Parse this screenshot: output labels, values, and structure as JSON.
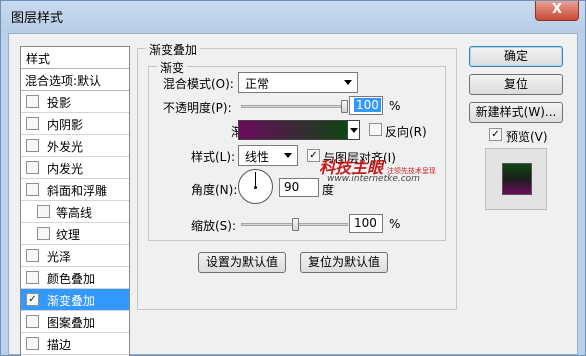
{
  "window": {
    "title": "图层样式",
    "close_label": "X"
  },
  "styles_list": {
    "header": "样式",
    "subheader": "混合选项:默认",
    "items": [
      {
        "label": "投影",
        "checked": false
      },
      {
        "label": "内阴影",
        "checked": false
      },
      {
        "label": "外发光",
        "checked": false
      },
      {
        "label": "内发光",
        "checked": false
      },
      {
        "label": "斜面和浮雕",
        "checked": false
      },
      {
        "label": "等高线",
        "checked": false
      },
      {
        "label": "纹理",
        "checked": false
      },
      {
        "label": "光泽",
        "checked": false
      },
      {
        "label": "颜色叠加",
        "checked": false
      },
      {
        "label": "渐变叠加",
        "checked": true,
        "selected": true
      },
      {
        "label": "图案叠加",
        "checked": false
      },
      {
        "label": "描边",
        "checked": false
      }
    ]
  },
  "gradient_overlay": {
    "group_title": "渐变叠加",
    "inner_group_title": "渐变",
    "blend_mode_label": "混合模式(O):",
    "blend_mode_value": "正常",
    "opacity_label": "不透明度(P):",
    "opacity_value": "100",
    "opacity_fraction": 1.0,
    "percent_sign": "%",
    "gradient_label": "渐变:",
    "gradient_colors": [
      "#6b0b5d",
      "#0f4513"
    ],
    "reverse_label": "反向(R)",
    "reverse_checked": false,
    "style_label": "样式(L):",
    "style_value": "线性",
    "align_label": "与图层对齐(I)",
    "align_checked": true,
    "angle_label": "角度(N):",
    "angle_value": "90",
    "angle_unit": "度",
    "scale_label": "缩放(S):",
    "scale_value": "100",
    "scale_fraction": 0.5,
    "make_default_button": "设置为默认值",
    "reset_default_button": "复位为默认值"
  },
  "side_buttons": {
    "ok": "确定",
    "reset": "复位",
    "new_style": "新建样式(W)...",
    "preview_label": "预览(V)",
    "preview_checked": true
  },
  "watermark": {
    "logo": "科技主眼",
    "tagline": "注领先技术呈现",
    "url": "www.internetke.com"
  }
}
